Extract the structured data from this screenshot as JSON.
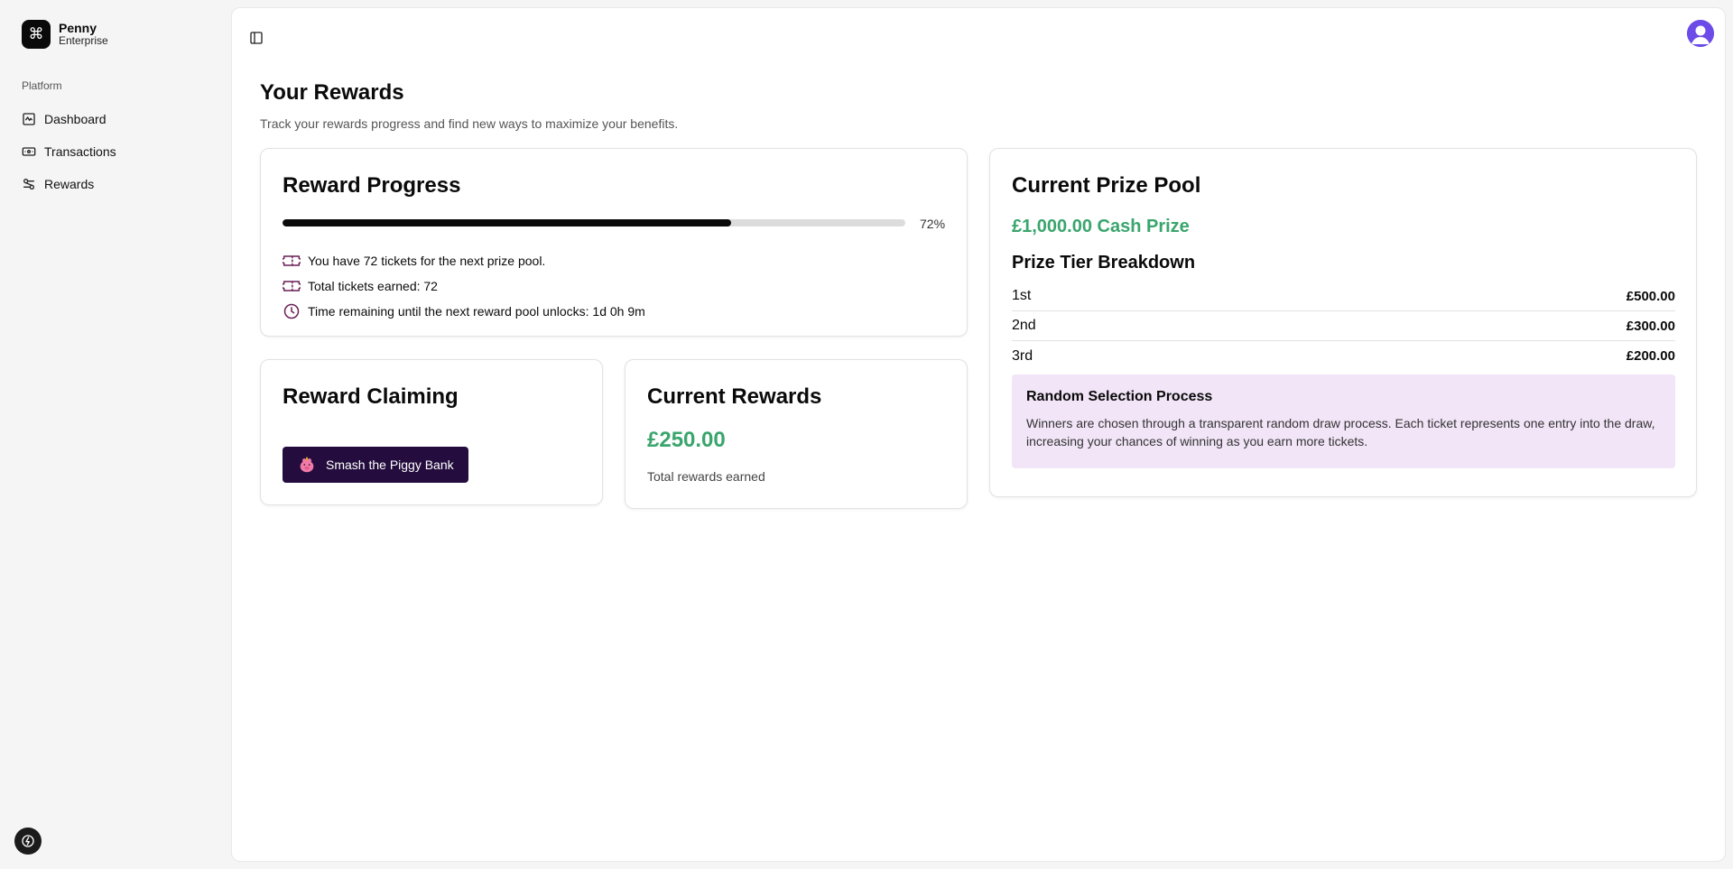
{
  "brand": {
    "name": "Penny",
    "subtitle": "Enterprise",
    "logo_glyph": "⌘"
  },
  "sidebar": {
    "group_label": "Platform",
    "items": [
      {
        "label": "Dashboard",
        "icon": "dashboard-icon"
      },
      {
        "label": "Transactions",
        "icon": "banknote-icon"
      },
      {
        "label": "Rewards",
        "icon": "rewards-icon"
      }
    ]
  },
  "page": {
    "title": "Your Rewards",
    "subtitle": "Track your rewards progress and find new ways to maximize your benefits."
  },
  "progress_card": {
    "title": "Reward Progress",
    "progress_percent": 72,
    "progress_label": "72%",
    "lines": [
      {
        "icon": "ticket-icon",
        "text": "You have 72 tickets for the next prize pool."
      },
      {
        "icon": "ticket-icon",
        "text": "Total tickets earned: 72"
      },
      {
        "icon": "clock-icon",
        "text": "Time remaining until the next reward pool unlocks: 1d 0h 9m"
      }
    ]
  },
  "claim_card": {
    "title": "Reward Claiming",
    "button_label": "Smash the Piggy Bank",
    "button_icon": "piggy-bank-icon"
  },
  "current_rewards": {
    "title": "Current Rewards",
    "amount": "£250.00",
    "label": "Total rewards earned"
  },
  "prize_pool": {
    "title": "Current Prize Pool",
    "cash_prize": "£1,000.00 Cash Prize",
    "tier_title": "Prize Tier Breakdown",
    "tiers": [
      {
        "place": "1st",
        "amount": "£500.00"
      },
      {
        "place": "2nd",
        "amount": "£300.00"
      },
      {
        "place": "3rd",
        "amount": "£200.00"
      }
    ],
    "selection_title": "Random Selection Process",
    "selection_text": "Winners are chosen through a transparent random draw process. Each ticket represents one entry into the draw, increasing your chances of winning as you earn more tickets."
  },
  "colors": {
    "accent_green": "#3aa56d",
    "button_bg": "#240d3e",
    "info_box_bg": "#f1e5f7",
    "icon_purple": "#6b1f57",
    "avatar": "#6d4be8"
  }
}
